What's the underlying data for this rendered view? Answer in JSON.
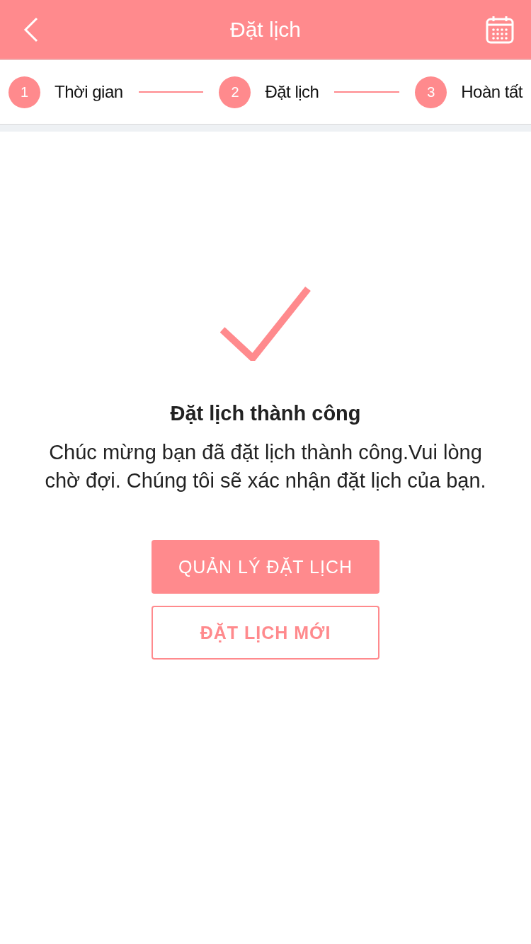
{
  "header": {
    "title": "Đặt lịch"
  },
  "steps": [
    {
      "number": "1",
      "label": "Thời gian"
    },
    {
      "number": "2",
      "label": "Đặt lịch"
    },
    {
      "number": "3",
      "label": "Hoàn tất"
    }
  ],
  "result": {
    "title": "Đặt lịch thành công",
    "message": "Chúc mừng bạn đã đặt lịch thành công.Vui lòng chờ đợi. Chúng tôi sẽ xác nhận đặt lịch của bạn."
  },
  "buttons": [
    {
      "label": "QUẢN LÝ ĐẶT LỊCH",
      "kind": "primary"
    },
    {
      "label": "ĐẶT LỊCH MỚI",
      "kind": "outline"
    }
  ]
}
